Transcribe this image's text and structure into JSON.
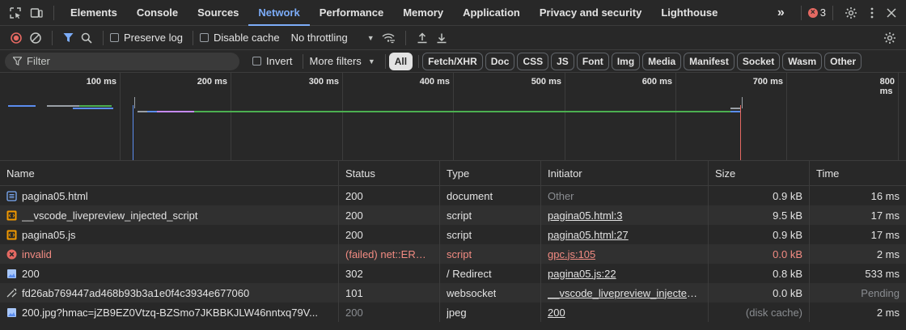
{
  "tabs": [
    {
      "label": "Elements",
      "active": false
    },
    {
      "label": "Console",
      "active": false
    },
    {
      "label": "Sources",
      "active": false
    },
    {
      "label": "Network",
      "active": true
    },
    {
      "label": "Performance",
      "active": false
    },
    {
      "label": "Memory",
      "active": false
    },
    {
      "label": "Application",
      "active": false
    },
    {
      "label": "Privacy and security",
      "active": false
    },
    {
      "label": "Lighthouse",
      "active": false
    }
  ],
  "tabbar": {
    "more": "»",
    "error_count": "3"
  },
  "toolbar": {
    "preserve_log": "Preserve log",
    "disable_cache": "Disable cache",
    "throttling": "No throttling"
  },
  "filterbar": {
    "filter_placeholder": "Filter",
    "invert": "Invert",
    "more_filters": "More filters",
    "types": [
      "All",
      "Fetch/XHR",
      "Doc",
      "CSS",
      "JS",
      "Font",
      "Img",
      "Media",
      "Manifest",
      "Socket",
      "Wasm",
      "Other"
    ],
    "active_type": "All"
  },
  "overview": {
    "ticks": [
      "100 ms",
      "200 ms",
      "300 ms",
      "400 ms",
      "500 ms",
      "600 ms",
      "700 ms",
      "800 ms"
    ]
  },
  "columns": {
    "name": "Name",
    "status": "Status",
    "type": "Type",
    "initiator": "Initiator",
    "size": "Size",
    "time": "Time"
  },
  "requests": [
    {
      "icon": "document-icon",
      "name": "pagina05.html",
      "status": "200",
      "type": "document",
      "initiator": "Other",
      "initiator_link": false,
      "size": "0.9 kB",
      "time": "16 ms",
      "error": false,
      "dim_status": false,
      "dim_size": false
    },
    {
      "icon": "script-icon",
      "name": "__vscode_livepreview_injected_script",
      "status": "200",
      "type": "script",
      "initiator": "pagina05.html:3",
      "initiator_link": true,
      "size": "9.5 kB",
      "time": "17 ms",
      "error": false,
      "dim_status": false,
      "dim_size": false
    },
    {
      "icon": "script-icon",
      "name": "pagina05.js",
      "status": "200",
      "type": "script",
      "initiator": "pagina05.html:27",
      "initiator_link": true,
      "size": "0.9 kB",
      "time": "17 ms",
      "error": false,
      "dim_status": false,
      "dim_size": false
    },
    {
      "icon": "error-icon",
      "name": "invalid",
      "status": "(failed) net::ERR_...",
      "type": "script",
      "initiator": "gpc.js:105",
      "initiator_link": true,
      "size": "0.0 kB",
      "time": "2 ms",
      "error": true,
      "dim_status": false,
      "dim_size": false
    },
    {
      "icon": "image-icon",
      "name": "200",
      "status": "302",
      "type": "/ Redirect",
      "initiator": "pagina05.js:22",
      "initiator_link": true,
      "size": "0.8 kB",
      "time": "533 ms",
      "error": false,
      "dim_status": false,
      "dim_size": false
    },
    {
      "icon": "websocket-icon",
      "name": "fd26ab769447ad468b93b3a1e0f4c3934e677060",
      "status": "101",
      "type": "websocket",
      "initiator": "__vscode_livepreview_injected_s",
      "initiator_link": true,
      "size": "0.0 kB",
      "time": "Pending",
      "error": false,
      "dim_status": false,
      "dim_size": false,
      "dim_time": true
    },
    {
      "icon": "image-icon",
      "name": "200.jpg?hmac=jZB9EZ0Vtzq-BZSmo7JKBBKJLW46nntxq79V...",
      "status": "200",
      "type": "jpeg",
      "initiator": "200",
      "initiator_link": true,
      "size": "(disk cache)",
      "time": "2 ms",
      "error": false,
      "dim_status": true,
      "dim_size": true
    }
  ],
  "colors": {
    "accent": "#7cacf8",
    "error": "#f28b82",
    "record": "#e46962",
    "waterfall_green": "#4caf50",
    "waterfall_blue": "#5b8def",
    "waterfall_purple": "#c58af9"
  }
}
